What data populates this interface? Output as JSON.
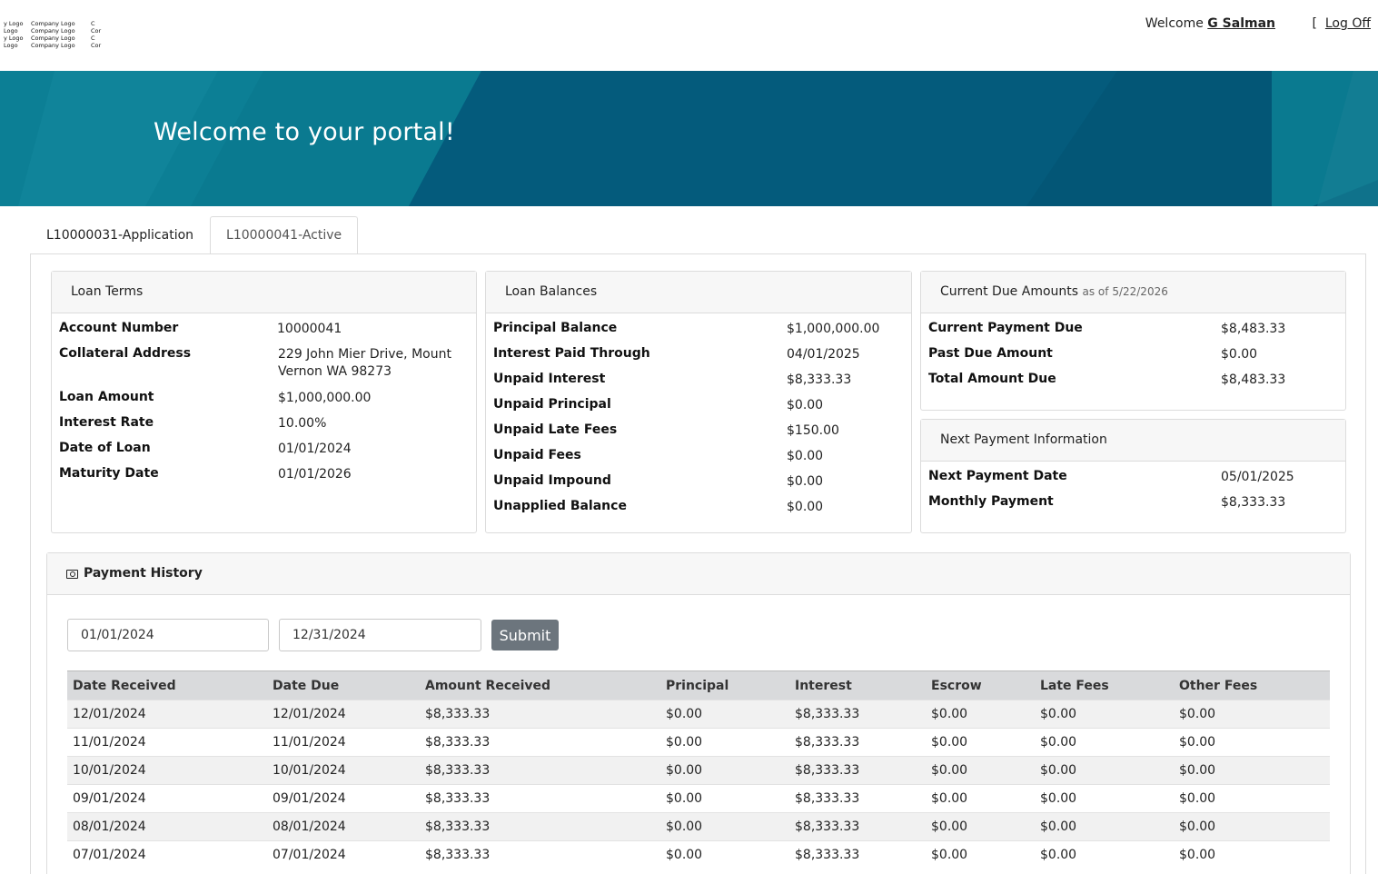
{
  "header": {
    "logo_text": [
      "y Logo",
      "Company Logo",
      "C",
      "Logo",
      "Company Logo",
      "Cor",
      "y Logo",
      "Company Logo",
      "C",
      "Logo",
      "Company Logo",
      "Cor"
    ],
    "welcome_prefix": "Welcome",
    "user_name": "G Salman",
    "logoff_bracket": "[",
    "logoff_label": "Log Off"
  },
  "banner": {
    "title": "Welcome to your portal!"
  },
  "tabs": [
    {
      "label": "L10000031-Application",
      "active": false
    },
    {
      "label": "L10000041-Active",
      "active": true
    }
  ],
  "loan_terms": {
    "title": "Loan Terms",
    "rows": [
      {
        "label": "Account Number",
        "value": "10000041"
      },
      {
        "label": "Collateral Address",
        "value": "229 John Mier Drive, Mount Vernon WA 98273"
      },
      {
        "label": "Loan Amount",
        "value": "$1,000,000.00"
      },
      {
        "label": "Interest Rate",
        "value": "10.00%"
      },
      {
        "label": "Date of Loan",
        "value": "01/01/2024"
      },
      {
        "label": "Maturity Date",
        "value": "01/01/2026"
      }
    ]
  },
  "loan_balances": {
    "title": "Loan Balances",
    "rows": [
      {
        "label": "Principal Balance",
        "value": "$1,000,000.00"
      },
      {
        "label": "Interest Paid Through",
        "value": "04/01/2025"
      },
      {
        "label": "Unpaid Interest",
        "value": "$8,333.33"
      },
      {
        "label": "Unpaid Principal",
        "value": "$0.00"
      },
      {
        "label": "Unpaid Late Fees",
        "value": "$150.00"
      },
      {
        "label": "Unpaid Fees",
        "value": "$0.00"
      },
      {
        "label": "Unpaid Impound",
        "value": "$0.00"
      },
      {
        "label": "Unapplied Balance",
        "value": "$0.00"
      }
    ]
  },
  "current_due": {
    "title": "Current Due Amounts",
    "as_of": "as of 5/22/2026",
    "rows": [
      {
        "label": "Current Payment Due",
        "value": "$8,483.33"
      },
      {
        "label": "Past Due Amount",
        "value": "$0.00"
      },
      {
        "label": "Total Amount Due",
        "value": "$8,483.33"
      }
    ]
  },
  "next_payment": {
    "title": "Next Payment Information",
    "rows": [
      {
        "label": "Next Payment Date",
        "value": "05/01/2025"
      },
      {
        "label": "Monthly Payment",
        "value": "$8,333.33"
      }
    ]
  },
  "payment_history": {
    "title": "Payment History",
    "start_date": "01/01/2024",
    "end_date": "12/31/2024",
    "submit_label": "Submit",
    "columns": [
      "Date Received",
      "Date Due",
      "Amount Received",
      "Principal",
      "Interest",
      "Escrow",
      "Late Fees",
      "Other Fees"
    ],
    "rows": [
      [
        "12/01/2024",
        "12/01/2024",
        "$8,333.33",
        "$0.00",
        "$8,333.33",
        "$0.00",
        "$0.00",
        "$0.00"
      ],
      [
        "11/01/2024",
        "11/01/2024",
        "$8,333.33",
        "$0.00",
        "$8,333.33",
        "$0.00",
        "$0.00",
        "$0.00"
      ],
      [
        "10/01/2024",
        "10/01/2024",
        "$8,333.33",
        "$0.00",
        "$8,333.33",
        "$0.00",
        "$0.00",
        "$0.00"
      ],
      [
        "09/01/2024",
        "09/01/2024",
        "$8,333.33",
        "$0.00",
        "$8,333.33",
        "$0.00",
        "$0.00",
        "$0.00"
      ],
      [
        "08/01/2024",
        "08/01/2024",
        "$8,333.33",
        "$0.00",
        "$8,333.33",
        "$0.00",
        "$0.00",
        "$0.00"
      ],
      [
        "07/01/2024",
        "07/01/2024",
        "$8,333.33",
        "$0.00",
        "$8,333.33",
        "$0.00",
        "$0.00",
        "$0.00"
      ]
    ]
  },
  "colors": {
    "banner": "#045b7c",
    "submit_button": "#6c757d"
  }
}
